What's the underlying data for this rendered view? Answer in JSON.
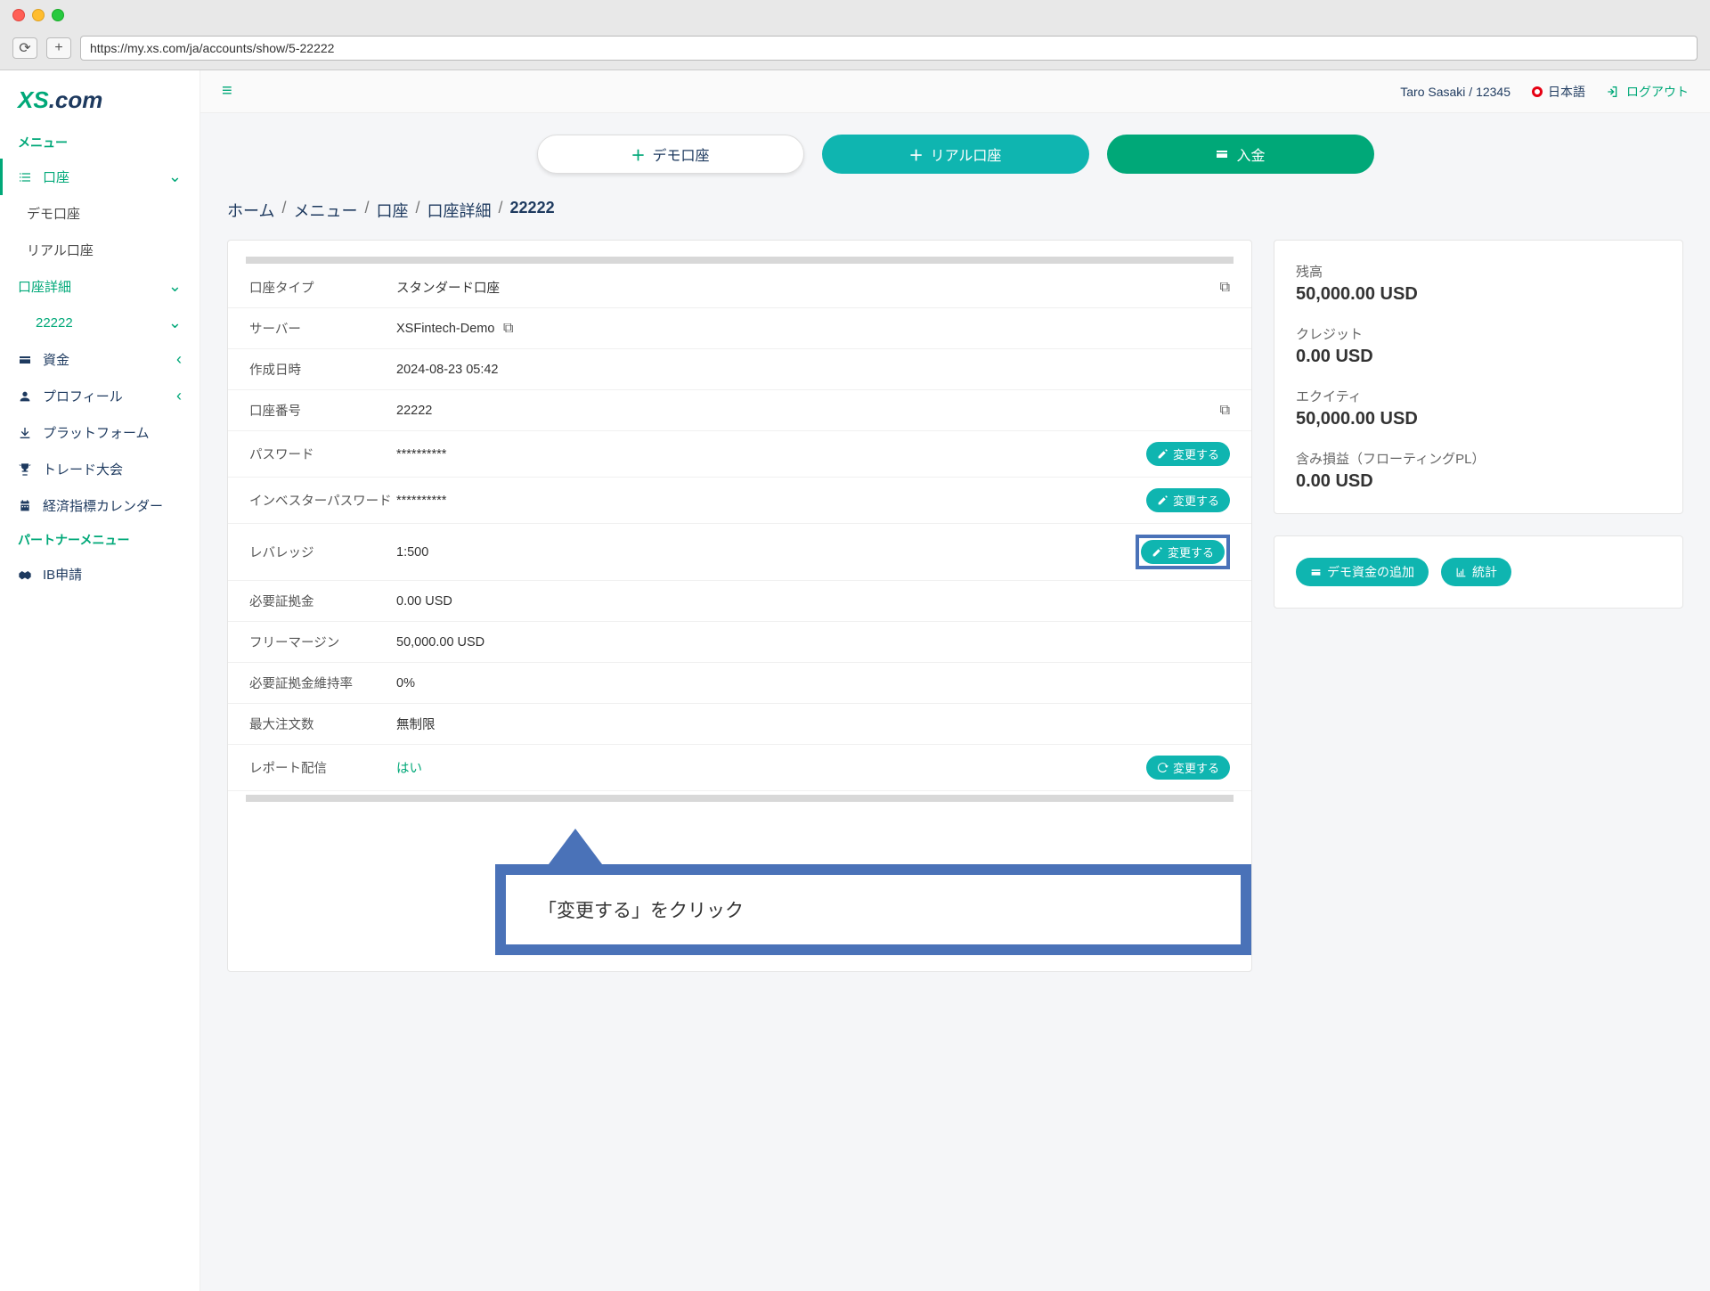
{
  "browser": {
    "url": "https://my.xs.com/ja/accounts/show/5-22222"
  },
  "logo": {
    "xs": "XS",
    "com": ".com"
  },
  "sidebar": {
    "menu_header": "メニュー",
    "partner_header": "パートナーメニュー",
    "items": {
      "accounts": "口座",
      "demo_account": "デモ口座",
      "real_account": "リアル口座",
      "account_details": "口座詳細",
      "account_number": "22222",
      "funds": "資金",
      "profile": "プロフィール",
      "platform": "プラットフォーム",
      "contest": "トレード大会",
      "calendar": "経済指標カレンダー",
      "ib_apply": "IB申請"
    }
  },
  "topbar": {
    "user": "Taro Sasaki / 12345",
    "language": "日本語",
    "logout": "ログアウト"
  },
  "actions": {
    "demo": "デモ口座",
    "real": "リアル口座",
    "deposit": "入金"
  },
  "breadcrumb": {
    "home": "ホーム",
    "menu": "メニュー",
    "accounts": "口座",
    "details": "口座詳細",
    "current": "22222"
  },
  "details": {
    "type_label": "口座タイプ",
    "type_value": "スタンダード口座",
    "server_label": "サーバー",
    "server_value": "XSFintech-Demo",
    "created_label": "作成日時",
    "created_value": "2024-08-23 05:42",
    "number_label": "口座番号",
    "number_value": "22222",
    "password_label": "パスワード",
    "password_value": "**********",
    "investor_label": "インベスターパスワード",
    "investor_value": "**********",
    "leverage_label": "レバレッジ",
    "leverage_value": "1:500",
    "margin_req_label": "必要証拠金",
    "margin_req_value": "0.00 USD",
    "free_margin_label": "フリーマージン",
    "free_margin_value": "50,000.00 USD",
    "margin_level_label": "必要証拠金維持率",
    "margin_level_value": "0%",
    "max_orders_label": "最大注文数",
    "max_orders_value": "無制限",
    "report_label": "レポート配信",
    "report_value": "はい",
    "change_btn": "変更する"
  },
  "stats": {
    "balance_label": "残高",
    "balance_value": "50,000.00 USD",
    "credit_label": "クレジット",
    "credit_value": "0.00 USD",
    "equity_label": "エクイティ",
    "equity_value": "50,000.00 USD",
    "floating_label": "含み損益（フローティングPL）",
    "floating_value": "0.00 USD"
  },
  "pills": {
    "add_demo_funds": "デモ資金の追加",
    "stats": "統計"
  },
  "callout": {
    "text": "「変更する」をクリック"
  }
}
